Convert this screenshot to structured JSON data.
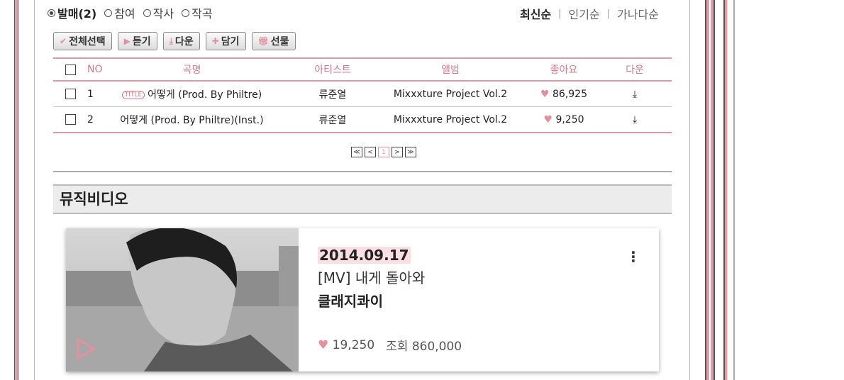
{
  "filters": {
    "options": [
      {
        "label": "발매(2)",
        "selected": true
      },
      {
        "label": "참여",
        "selected": false
      },
      {
        "label": "작사",
        "selected": false
      },
      {
        "label": "작곡",
        "selected": false
      }
    ]
  },
  "sort": {
    "options": [
      "최신순",
      "인기순",
      "가나다순"
    ],
    "active": "최신순"
  },
  "toolbar": {
    "select_all": "전체선택",
    "listen": "듣기",
    "download": "다운",
    "add": "담기",
    "gift": "선물"
  },
  "table": {
    "headers": {
      "no": "NO",
      "title": "곡명",
      "artist": "아티스트",
      "album": "앨범",
      "likes": "좋아요",
      "down": "다운"
    },
    "rows": [
      {
        "no": "1",
        "title_tag": "TITLE",
        "title": "어떻게 (Prod. By Philtre)",
        "artist": "류준열",
        "album": "Mixxxture Project Vol.2",
        "likes": "86,925"
      },
      {
        "no": "2",
        "title_tag": "",
        "title": "어떻게 (Prod. By Philtre)(Inst.)",
        "artist": "류준열",
        "album": "Mixxxture Project Vol.2",
        "likes": "9,250"
      }
    ]
  },
  "pagination": {
    "first": "≪",
    "prev": "<",
    "current": "1",
    "next": ">",
    "last": "≫"
  },
  "section": {
    "title": "뮤직비디오"
  },
  "video": {
    "date": "2014.09.17",
    "title": "[MV] 내게 돌아와",
    "artist": "클래지콰이",
    "likes": "19,250",
    "views": "조회 860,000"
  },
  "colors": {
    "accent": "#e5909f",
    "border_pink": "#dd97a6",
    "header_text": "#d37a8c",
    "frame": "#d9a1ae"
  }
}
